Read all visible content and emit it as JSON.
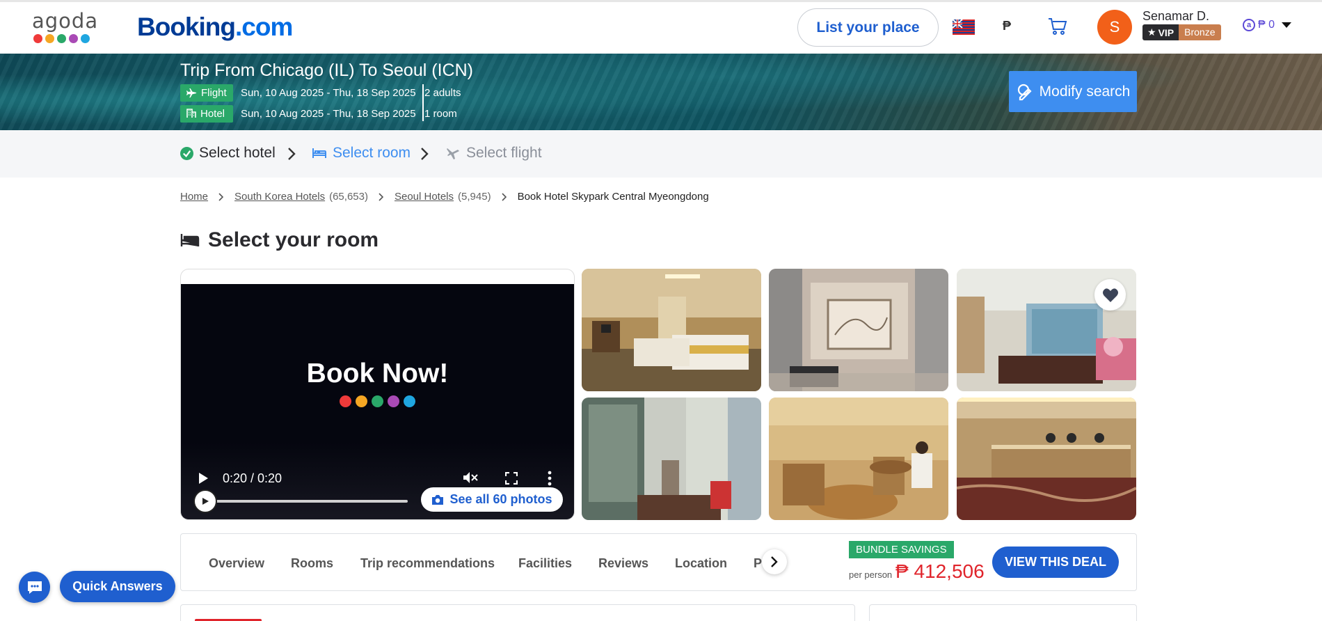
{
  "header": {
    "agoda_logo_text": "agoda",
    "agoda_dot_colors": [
      "#ef3a3a",
      "#f5a623",
      "#2aa869",
      "#a94ab5",
      "#1fa6e0"
    ],
    "booking_brand": "Booking",
    "booking_domain": ".com",
    "list_place_label": "List your place",
    "language_flag": "flag-uk-icon",
    "currency_symbol": "₱",
    "cart_icon": "cart-icon",
    "avatar_initial": "S",
    "user_name": "Senamar D.",
    "vip_label": "VIP",
    "tier_label": "Bronze",
    "points_label": "₱ 0"
  },
  "trip": {
    "title": "Trip From Chicago (IL) To Seoul (ICN)",
    "flight_tag": "Flight",
    "flight_dates": "Sun, 10 Aug 2025 - Thu, 18 Sep 2025",
    "travelers": "2 adults",
    "hotel_tag": "Hotel",
    "hotel_dates": "Sun, 10 Aug 2025 - Thu, 18 Sep 2025",
    "rooms": "1 room",
    "modify_label": "Modify search"
  },
  "steps": {
    "select_hotel": "Select hotel",
    "select_room": "Select room",
    "select_flight": "Select flight"
  },
  "breadcrumb": {
    "home": "Home",
    "country": "South Korea Hotels",
    "country_count": "(65,653)",
    "city": "Seoul Hotels",
    "city_count": "(5,945)",
    "current": "Book Hotel Skypark Central Myeongdong"
  },
  "room_section": {
    "title": "Select your room"
  },
  "gallery": {
    "video_title": "Book Now!",
    "video_time": "0:20 / 0:20",
    "see_all_label": "See all 60 photos"
  },
  "tabs": [
    "Overview",
    "Rooms",
    "Trip recommendations",
    "Facilities",
    "Reviews",
    "Location",
    "Policies"
  ],
  "deal": {
    "bundle_label": "BUNDLE SAVINGS",
    "per_person_label": "per person",
    "price": "₱ 412,506",
    "cta_label": "VIEW THIS DEAL"
  },
  "support": {
    "quick_answers_label": "Quick Answers"
  },
  "colors": {
    "primary_blue": "#1f5fcf",
    "accent_green": "#2aa869",
    "price_red": "#e0242b",
    "avatar_orange": "#f26019"
  }
}
